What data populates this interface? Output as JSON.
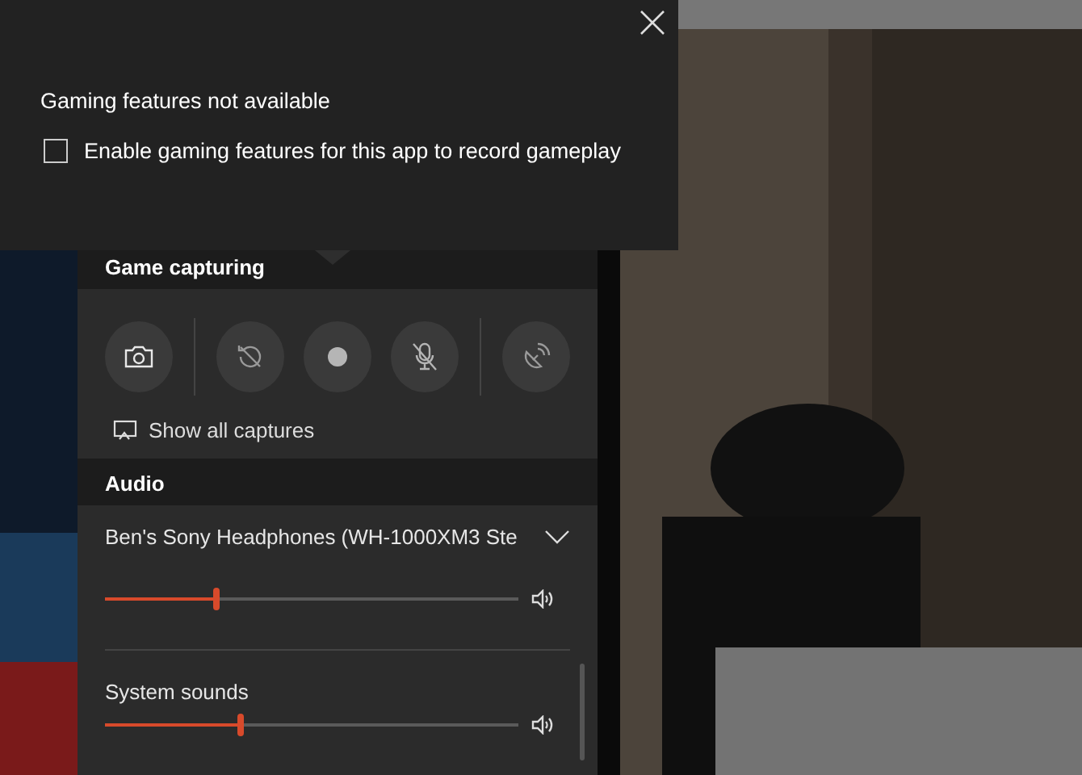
{
  "notice": {
    "title": "Gaming features not available",
    "checkbox": {
      "label": "Enable gaming features for this app to record gameplay",
      "checked": false
    }
  },
  "capture": {
    "title": "Game capturing",
    "buttons": [
      {
        "kind": "screenshot"
      },
      {
        "kind": "record-last"
      },
      {
        "kind": "record"
      },
      {
        "kind": "mic"
      },
      {
        "kind": "broadcast"
      }
    ],
    "link": "Show all captures"
  },
  "audio": {
    "title": "Audio",
    "mixers": [
      {
        "kind": "device",
        "name": "Ben's Sony Headphones (WH-1000XM3 Ste",
        "level": 0.27
      },
      {
        "kind": "app",
        "name": "System sounds",
        "level": 0.33
      }
    ]
  }
}
